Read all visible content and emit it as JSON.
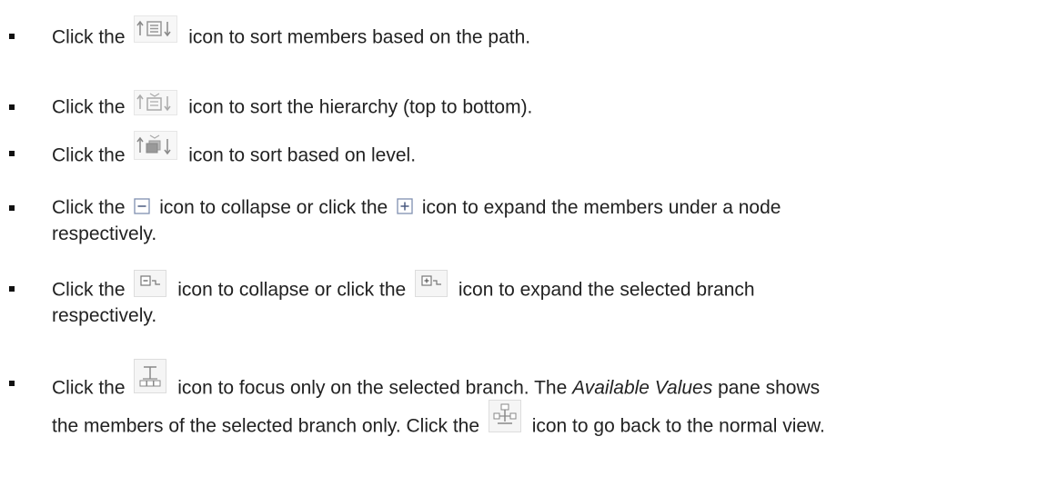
{
  "items": [
    {
      "prefix": "Click the",
      "icon": "sort-path-icon",
      "suffix": "icon to sort members based on the path."
    },
    {
      "prefix": "Click the",
      "icon": "sort-hierarchy-icon",
      "suffix": "icon to sort the hierarchy (top to bottom)."
    },
    {
      "prefix": "Click the",
      "icon": "sort-level-icon",
      "suffix": "icon to sort based on level."
    },
    {
      "prefix": "Click the",
      "icon1": "collapse-icon",
      "middle": "icon to collapse or click the",
      "icon2": "expand-icon",
      "suffix": "icon to expand the members under a node",
      "continuation": "respectively."
    },
    {
      "prefix": "Click the",
      "icon1": "collapse-branch-icon",
      "middle": "icon to collapse or click the",
      "icon2": "expand-branch-icon",
      "suffix": "icon to expand the selected branch",
      "continuation": "respectively."
    },
    {
      "prefix": "Click the",
      "icon1": "focus-branch-icon",
      "middle_a": "icon to focus only on the selected branch. The",
      "emphasis": "Available Values",
      "middle_b": "pane shows",
      "continuation_a": "the members of the selected branch only. Click the",
      "icon2": "normal-view-icon",
      "continuation_b": "icon to go back to the normal view."
    }
  ]
}
